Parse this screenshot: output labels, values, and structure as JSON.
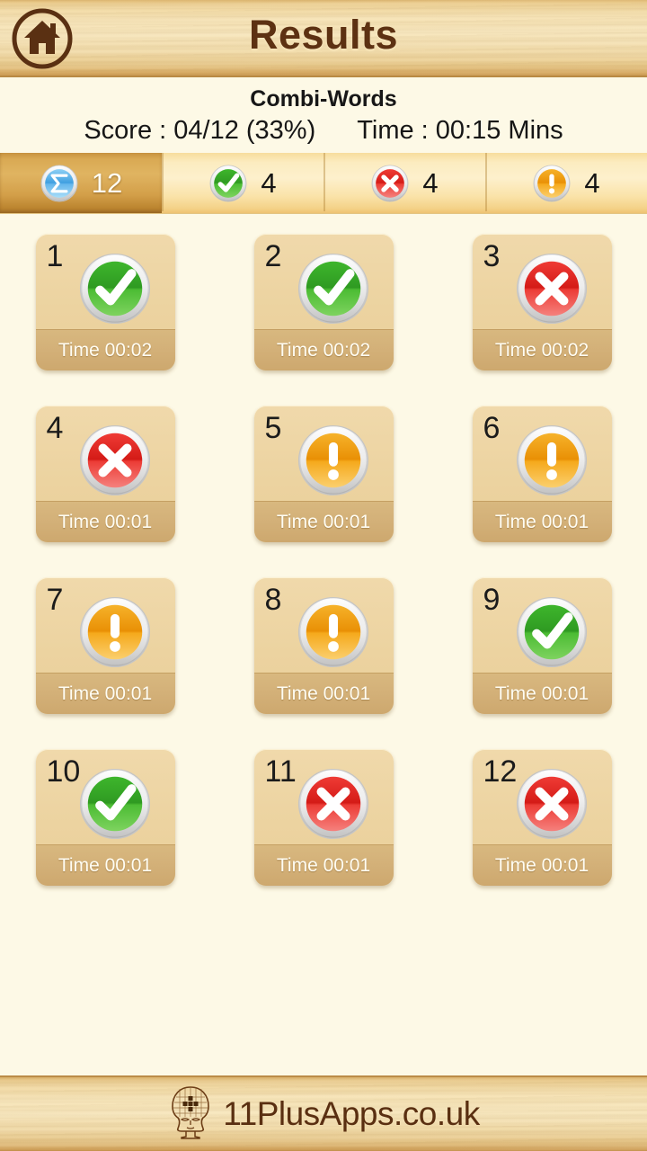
{
  "header": {
    "title": "Results",
    "home_icon": "home-icon"
  },
  "info": {
    "quiz_name": "Combi-Words",
    "score_text": "Score : 04/12 (33%)",
    "time_text": "Time : 00:15 Mins"
  },
  "tabs": [
    {
      "icon": "sigma-total-icon",
      "count": "12",
      "selected": true
    },
    {
      "icon": "check-correct-icon",
      "count": "4",
      "selected": false
    },
    {
      "icon": "cross-wrong-icon",
      "count": "4",
      "selected": false
    },
    {
      "icon": "exclamation-skipped-icon",
      "count": "4",
      "selected": false
    }
  ],
  "results": [
    {
      "number": "1",
      "status": "correct",
      "icon": "check-correct-icon",
      "time_label": "Time 00:02"
    },
    {
      "number": "2",
      "status": "correct",
      "icon": "check-correct-icon",
      "time_label": "Time 00:02"
    },
    {
      "number": "3",
      "status": "wrong",
      "icon": "cross-wrong-icon",
      "time_label": "Time 00:02"
    },
    {
      "number": "4",
      "status": "wrong",
      "icon": "cross-wrong-icon",
      "time_label": "Time 00:01"
    },
    {
      "number": "5",
      "status": "skipped",
      "icon": "exclamation-skipped-icon",
      "time_label": "Time 00:01"
    },
    {
      "number": "6",
      "status": "skipped",
      "icon": "exclamation-skipped-icon",
      "time_label": "Time 00:01"
    },
    {
      "number": "7",
      "status": "skipped",
      "icon": "exclamation-skipped-icon",
      "time_label": "Time 00:01"
    },
    {
      "number": "8",
      "status": "skipped",
      "icon": "exclamation-skipped-icon",
      "time_label": "Time 00:01"
    },
    {
      "number": "9",
      "status": "correct",
      "icon": "check-correct-icon",
      "time_label": "Time 00:01"
    },
    {
      "number": "10",
      "status": "correct",
      "icon": "check-correct-icon",
      "time_label": "Time 00:01"
    },
    {
      "number": "11",
      "status": "wrong",
      "icon": "cross-wrong-icon",
      "time_label": "Time 00:01"
    },
    {
      "number": "12",
      "status": "wrong",
      "icon": "cross-wrong-icon",
      "time_label": "Time 00:01"
    }
  ],
  "footer": {
    "brand": "11PlusApps.co.uk",
    "logo_icon": "phrenology-head-icon"
  },
  "colors": {
    "correct_green": "#34a127",
    "wrong_red": "#e02a25",
    "skipped_orange": "#eea215",
    "total_blue": "#4ea8e8",
    "wood": "#f2dcab",
    "page_bg": "#fdf9e6",
    "card_body": "#ecd3a0",
    "card_footer": "#d3b078",
    "title_brown": "#5d3112",
    "tab_selected": "#d9a953"
  }
}
